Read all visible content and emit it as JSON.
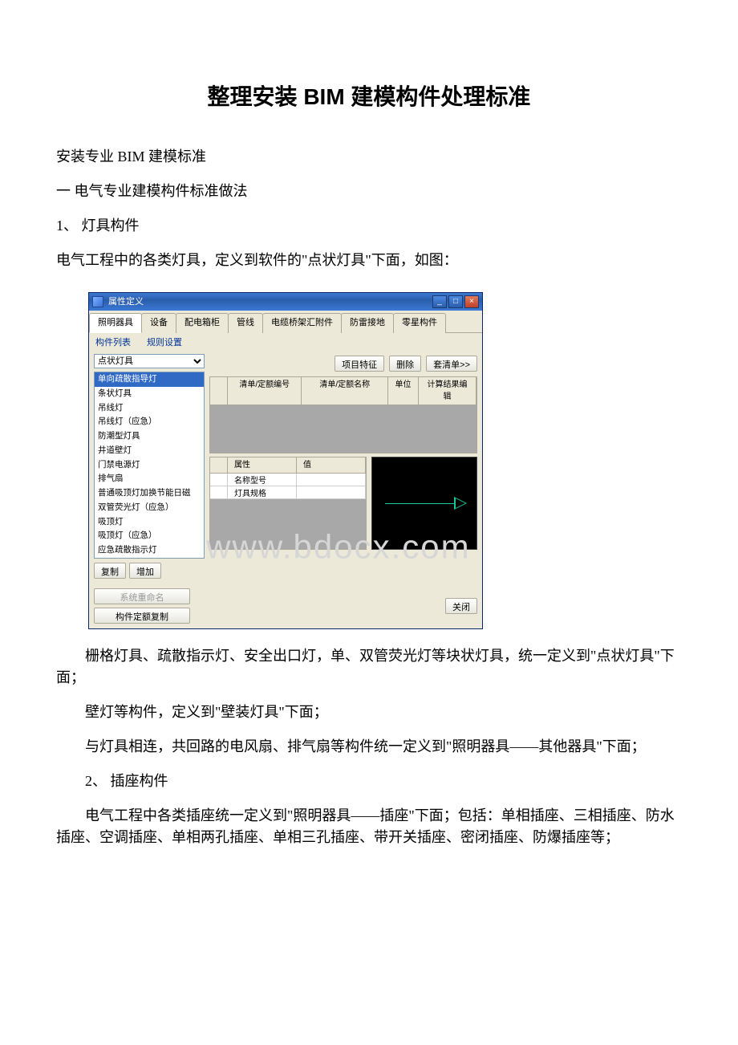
{
  "page": {
    "title": "整理安装 BIM 建模构件处理标准",
    "h2": "安装专业 BIM 建模标准",
    "h3": "一 电气专业建模构件标准做法",
    "s1_head": "1、 灯具构件",
    "s1_p1": "电气工程中的各类灯具，定义到软件的\"点状灯具\"下面，如图：",
    "s1_p2": "栅格灯具、疏散指示灯、安全出口灯，单、双管荧光灯等块状灯具，统一定义到\"点状灯具\"下面；",
    "s1_p3": "壁灯等构件，定义到\"壁装灯具\"下面；",
    "s1_p4": "与灯具相连，共回路的电风扇、排气扇等构件统一定义到\"照明器具——其他器具\"下面；",
    "s2_head": "2、 插座构件",
    "s2_p1": "电气工程中各类插座统一定义到\"照明器具——插座\"下面；包括：单相插座、三相插座、防水插座、空调插座、单相两孔插座、单相三孔插座、带开关插座、密闭插座、防爆插座等；"
  },
  "app": {
    "window_title": "属性定义",
    "tabs": [
      "照明器具",
      "设备",
      "配电箱柜",
      "管线",
      "电缆桥架汇附件",
      "防雷接地",
      "零星构件"
    ],
    "active_tab_index": 0,
    "links": {
      "list": "构件列表",
      "rules": "规则设置"
    },
    "dropdown_value": "点状灯具",
    "list_items": [
      "单向疏散指导灯",
      "条状灯具",
      "吊线灯",
      "吊线灯（应急）",
      "防潮型灯具",
      "井道壁灯",
      "门禁电源灯",
      "排气扇",
      "普通吸顶灯加换节能日磁",
      "双管荧光灯（应急）",
      "吸顶灯",
      "吸顶灯（应急）",
      "应急疏散指示灯"
    ],
    "selected_list_index": 0,
    "buttons": {
      "copy": "复制",
      "add": "增加",
      "rename": "系统重命名",
      "comp_copy": "构件定额复制",
      "proj_feat": "项目特征",
      "delete": "删除",
      "to_list": "套清单>>",
      "close": "关闭"
    },
    "grid1_headers": [
      "",
      "清单/定额编号",
      "清单/定额名称",
      "单位",
      "计算结果编辑"
    ],
    "grid2_headers": [
      "",
      "属性",
      "值"
    ],
    "grid2_rows": [
      {
        "attr": "名称型号",
        "val": ""
      },
      {
        "attr": "灯具规格",
        "val": ""
      }
    ]
  },
  "watermark": "www.bdocx.com"
}
